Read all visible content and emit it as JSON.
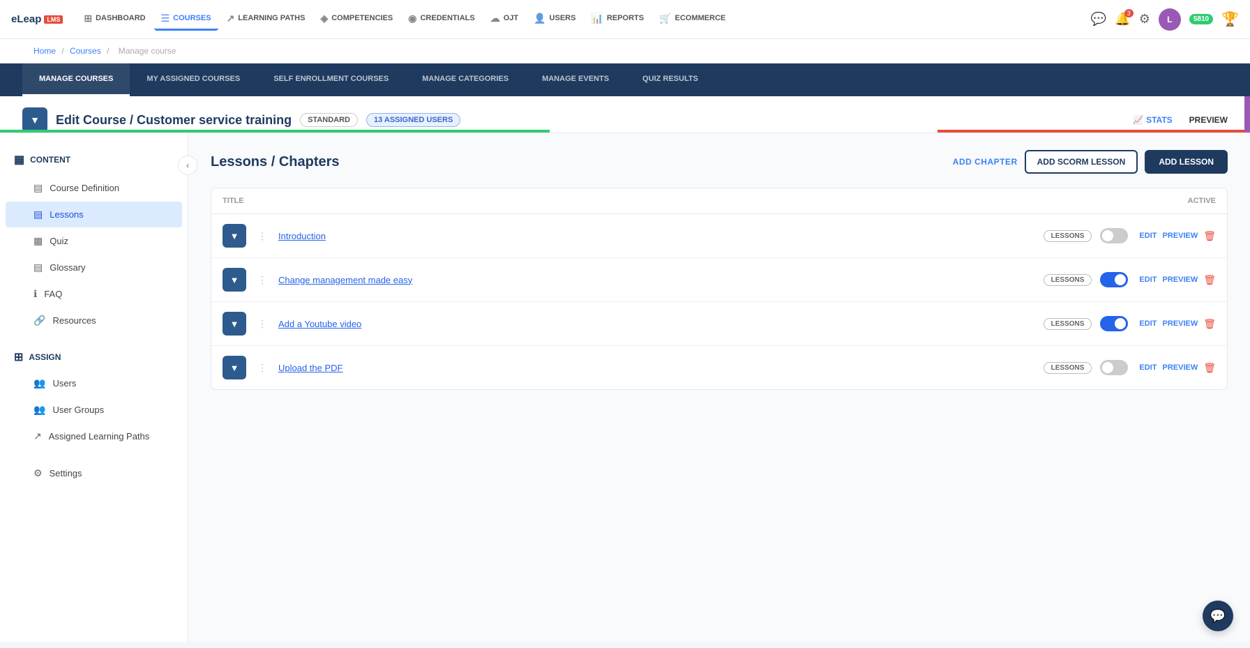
{
  "logo": {
    "text": "eLeap",
    "lms": "LMS"
  },
  "nav": {
    "items": [
      {
        "id": "dashboard",
        "label": "Dashboard",
        "icon": "⊞",
        "active": false
      },
      {
        "id": "courses",
        "label": "Courses",
        "icon": "☰",
        "active": true
      },
      {
        "id": "learning-paths",
        "label": "Learning Paths",
        "icon": "↗",
        "active": false
      },
      {
        "id": "competencies",
        "label": "Competencies",
        "icon": "◈",
        "active": false
      },
      {
        "id": "credentials",
        "label": "Credentials",
        "icon": "◉",
        "active": false
      },
      {
        "id": "ojt",
        "label": "OJT",
        "icon": "☁",
        "active": false
      },
      {
        "id": "users",
        "label": "Users",
        "icon": "👤",
        "active": false
      },
      {
        "id": "reports",
        "label": "Reports",
        "icon": "📊",
        "active": false
      },
      {
        "id": "ecommerce",
        "label": "Ecommerce",
        "icon": "🛒",
        "active": false
      }
    ],
    "notification_count": "3",
    "points": "5810",
    "avatar_initials": "L"
  },
  "breadcrumb": {
    "home": "Home",
    "courses": "Courses",
    "current": "Manage course"
  },
  "tabs": [
    {
      "id": "manage-courses",
      "label": "Manage Courses",
      "active": true
    },
    {
      "id": "my-assigned-courses",
      "label": "My Assigned Courses",
      "active": false
    },
    {
      "id": "self-enrollment",
      "label": "Self Enrollment Courses",
      "active": false
    },
    {
      "id": "manage-categories",
      "label": "Manage Categories",
      "active": false
    },
    {
      "id": "manage-events",
      "label": "Manage Events",
      "active": false
    },
    {
      "id": "quiz-results",
      "label": "Quiz Results",
      "active": false
    }
  ],
  "edit_course": {
    "title": "Edit Course / Customer service training",
    "badge_standard": "STANDARD",
    "badge_assigned": "13 ASSIGNED USERS",
    "stats_label": "STATS",
    "preview_label": "PREVIEW"
  },
  "sidebar": {
    "content_section": {
      "title": "CONTENT",
      "icon": "content-icon"
    },
    "content_items": [
      {
        "id": "course-definition",
        "label": "Course Definition",
        "icon": "📋",
        "active": false
      },
      {
        "id": "lessons",
        "label": "Lessons",
        "icon": "📄",
        "active": true
      },
      {
        "id": "quiz",
        "label": "Quiz",
        "icon": "📋",
        "active": false
      },
      {
        "id": "glossary",
        "label": "Glossary",
        "icon": "📒",
        "active": false
      },
      {
        "id": "faq",
        "label": "FAQ",
        "icon": "ℹ",
        "active": false
      },
      {
        "id": "resources",
        "label": "Resources",
        "icon": "🔗",
        "active": false
      }
    ],
    "assign_section": {
      "title": "ASSIGN",
      "icon": "assign-icon"
    },
    "assign_items": [
      {
        "id": "users",
        "label": "Users",
        "icon": "👥",
        "active": false
      },
      {
        "id": "user-groups",
        "label": "User Groups",
        "icon": "👥",
        "active": false
      },
      {
        "id": "assigned-learning-paths",
        "label": "Assigned Learning Paths",
        "icon": "↗",
        "active": false
      }
    ],
    "settings_item": {
      "id": "settings",
      "label": "Settings",
      "icon": "⚙",
      "active": false
    }
  },
  "lessons_page": {
    "title": "Lessons / Chapters",
    "add_chapter_label": "ADD CHAPTER",
    "add_scorm_label": "ADD SCORM LESSON",
    "add_lesson_label": "ADD LESSON",
    "table_col_title": "TITLE",
    "table_col_active": "ACTIVE",
    "lessons": [
      {
        "id": 1,
        "name": "Introduction",
        "tag": "LESSONS",
        "active": false
      },
      {
        "id": 2,
        "name": "Change management made easy",
        "tag": "LESSONS",
        "active": true
      },
      {
        "id": 3,
        "name": "Add a Youtube video",
        "tag": "LESSONS",
        "active": true
      },
      {
        "id": 4,
        "name": "Upload the PDF",
        "tag": "LESSONS",
        "active": false
      }
    ],
    "action_edit": "EDIT",
    "action_preview": "PREVIEW"
  }
}
